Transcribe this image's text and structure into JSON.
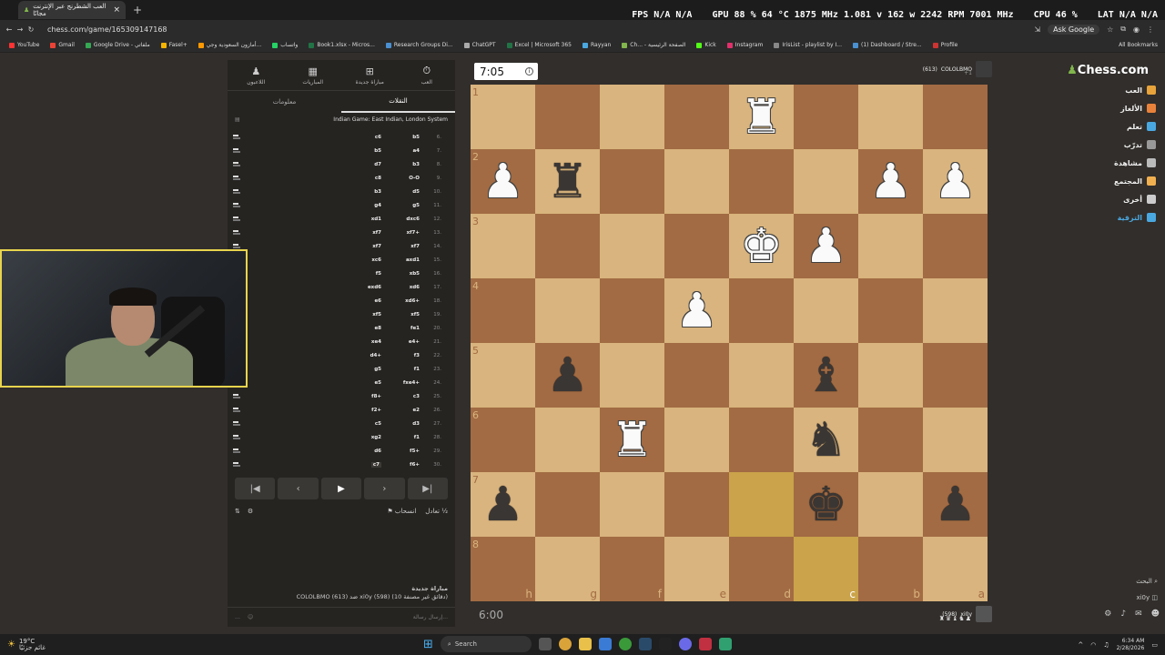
{
  "browser": {
    "tab_title": "العب الشطرنج عبر الإنترنت مجانًا",
    "url": "chess.com/game/165309147168",
    "ask_label": "Ask Google"
  },
  "hud": {
    "fps": "FPS N/A N/A",
    "gpu": "GPU 88 % 64 °C 1875 MHz 1.081 v 162 w 2242 RPM 7001 MHz",
    "cpu": "CPU 46 %",
    "lat": "LAT N/A N/A"
  },
  "bookmarks": [
    "YouTube",
    "Gmail",
    "Google Drive - ملفاتي",
    "Fasel+",
    "أمازون السعودية وجي...",
    "واتساب",
    "Book1.xlsx - Micros...",
    "Research Groups Di...",
    "ChatGPT",
    "Excel | Microsoft 365",
    "Rayyan",
    "Ch... - الصفحة الرئيسية",
    "Kick",
    "Instagram",
    "IrisList - playlist by I...",
    "(1) Dashboard / Stre...",
    "Profile"
  ],
  "bookmarks_all": "All Bookmarks",
  "panel": {
    "tabs": [
      {
        "label": "العب",
        "icon": "stopwatch-icon"
      },
      {
        "label": "مباراة جديدة",
        "icon": "plus-icon"
      },
      {
        "label": "المباريات",
        "icon": "grid-icon"
      },
      {
        "label": "اللاعبون",
        "icon": "players-icon"
      }
    ],
    "subtabs": [
      "النقلات",
      "معلومات"
    ],
    "opening": "Indian Game: East Indian, London System",
    "moves": [
      {
        "n": "6.",
        "w": "b5",
        "b": "c6"
      },
      {
        "n": "7.",
        "w": "a4",
        "b": "b5"
      },
      {
        "n": "8.",
        "w": "b3",
        "b": "d7"
      },
      {
        "n": "9.",
        "w": "O-O",
        "b": "c8"
      },
      {
        "n": "10.",
        "w": "d5",
        "b": "b3"
      },
      {
        "n": "11.",
        "w": "g5",
        "b": "g4"
      },
      {
        "n": "12.",
        "w": "dxc6",
        "b": "xd1"
      },
      {
        "n": "13.",
        "w": "xf7+",
        "b": "xf7"
      },
      {
        "n": "14.",
        "w": "xf7",
        "b": "xf7"
      },
      {
        "n": "15.",
        "w": "axd1",
        "b": "xc6"
      },
      {
        "n": "16.",
        "w": "xb5",
        "b": "f5"
      },
      {
        "n": "17.",
        "w": "xd6",
        "b": "exd6"
      },
      {
        "n": "18.",
        "w": "xd6+",
        "b": "e6"
      },
      {
        "n": "19.",
        "w": "xf5",
        "b": "xf5"
      },
      {
        "n": "20.",
        "w": "fe1",
        "b": "e8"
      },
      {
        "n": "21.",
        "w": "e4+",
        "b": "xe4"
      },
      {
        "n": "22.",
        "w": "f3",
        "b": "d4+"
      },
      {
        "n": "23.",
        "w": "f1",
        "b": "g5"
      },
      {
        "n": "24.",
        "w": "fxe4+",
        "b": "e5"
      },
      {
        "n": "25.",
        "w": "c3",
        "b": "f8+"
      },
      {
        "n": "26.",
        "w": "e2",
        "b": "f2+"
      },
      {
        "n": "27.",
        "w": "d3",
        "b": "c5"
      },
      {
        "n": "28.",
        "w": "f1",
        "b": "xg2"
      },
      {
        "n": "29.",
        "w": "f5+",
        "b": "d6"
      },
      {
        "n": "30.",
        "w": "f6+",
        "b": "c7"
      }
    ],
    "actions": {
      "draw": "تعادل",
      "resign": "انسحاب"
    },
    "game_title": "مباراة جديدة",
    "game_desc": "COLOLBMO (613) ضد xi0y (598) (10 دقائق غير مصنفة)",
    "chat_placeholder": "إرسال رسالة..."
  },
  "clocks": {
    "top": "7:05",
    "bottom": "6:00"
  },
  "players": {
    "top": {
      "name": "COLOLBMO",
      "rating": "(613)",
      "captured": "+1"
    },
    "bottom": {
      "name": "xi0y",
      "rating": "(598)",
      "captured": "♜♛♝♞♟"
    }
  },
  "board": {
    "ranks": [
      "1",
      "2",
      "3",
      "4",
      "5",
      "6",
      "7",
      "8"
    ],
    "files": [
      "h",
      "g",
      "f",
      "e",
      "d",
      "c",
      "b",
      "a"
    ],
    "squares": [
      [
        "",
        "",
        "",
        "",
        "R",
        "",
        "",
        ""
      ],
      [
        "P",
        "r",
        "",
        "",
        "",
        "",
        "P",
        "P"
      ],
      [
        "",
        "",
        "",
        "",
        "K",
        "P",
        "",
        ""
      ],
      [
        "",
        "",
        "",
        "P",
        "",
        "",
        "",
        ""
      ],
      [
        "",
        "p",
        "",
        "",
        "",
        "b",
        "",
        ""
      ],
      [
        "",
        "",
        "R",
        "",
        "",
        "n",
        "",
        ""
      ],
      [
        "p",
        "",
        "",
        "",
        "",
        "k",
        "",
        "p"
      ],
      [
        "",
        "",
        "",
        "",
        "",
        "",
        "",
        ""
      ]
    ],
    "highlights": [
      "6-4",
      "7-5"
    ]
  },
  "nav": {
    "logo": "Chess.com",
    "items": [
      {
        "label": "العب",
        "color": "#e8a33b"
      },
      {
        "label": "الألغاز",
        "color": "#e8823b"
      },
      {
        "label": "تعلم",
        "color": "#4aa8e0"
      },
      {
        "label": "تدرّب",
        "color": "#999999"
      },
      {
        "label": "مشاهدة",
        "color": "#bbbbbb"
      },
      {
        "label": "المجتمع",
        "color": "#f0b050"
      },
      {
        "label": "أخرى",
        "color": "#cccccc"
      },
      {
        "label": "الترقية",
        "color": "#4aa8e0"
      }
    ],
    "search": "البحث",
    "user": "xi0y"
  },
  "taskbar": {
    "temp": "19°C",
    "weather": "غائم جزئيًا",
    "search": "Search",
    "time": "6:34 AM",
    "date": "2/28/2026"
  }
}
